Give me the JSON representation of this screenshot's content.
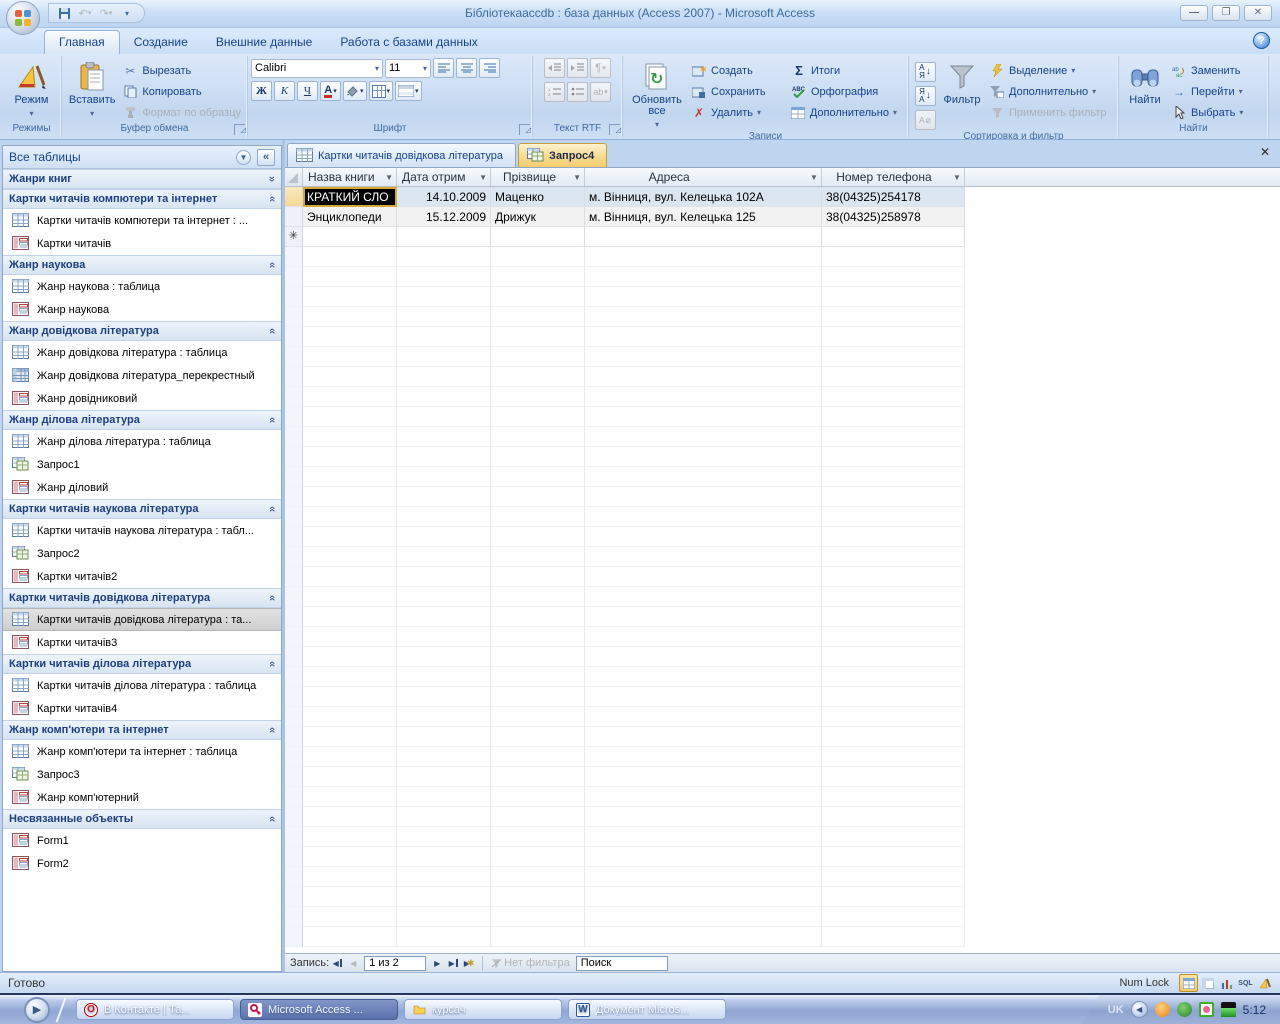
{
  "title_bar": {
    "title": "Бібліотекаaccdb : база данных (Access 2007) - Microsoft Access",
    "minimize": "—",
    "restore": "❐",
    "close": "✕"
  },
  "ribbon": {
    "tabs": [
      "Главная",
      "Создание",
      "Внешние данные",
      "Работа с базами данных"
    ],
    "groups": {
      "views": {
        "label": "Режимы",
        "view_button": "Режим"
      },
      "clipboard": {
        "label": "Буфер обмена",
        "paste": "Вставить",
        "cut": "Вырезать",
        "copy": "Копировать",
        "format_painter": "Формат по образцу"
      },
      "font": {
        "label": "Шрифт",
        "font_name": "Calibri",
        "font_size": "11",
        "bold": "Ж",
        "italic": "К",
        "underline": "Ч"
      },
      "rich_text": {
        "label": "Текст RTF"
      },
      "records": {
        "label": "Записи",
        "refresh": "Обновить все",
        "new": "Создать",
        "save": "Сохранить",
        "delete": "Удалить",
        "totals": "Итоги",
        "spelling": "Орфография",
        "more": "Дополнительно"
      },
      "sort_filter": {
        "label": "Сортировка и фильтр",
        "filter": "Фильтр",
        "selection": "Выделение",
        "advanced": "Дополнительно",
        "toggle_filter": "Применить фильтр"
      },
      "find": {
        "label": "Найти",
        "find": "Найти",
        "replace": "Заменить",
        "goto": "Перейти",
        "select": "Выбрать"
      }
    }
  },
  "nav": {
    "header": "Все таблицы",
    "groups": [
      {
        "title": "Жанри книг"
      },
      {
        "title": "Картки читачів компютери та інтернет",
        "items": [
          {
            "label": "Картки читачів компютери та інтернет : ..."
          },
          {
            "label": "Картки читачів"
          }
        ]
      },
      {
        "title": "Жанр наукова",
        "items": [
          {
            "label": "Жанр наукова : таблица"
          },
          {
            "label": "Жанр наукова"
          }
        ]
      },
      {
        "title": "Жанр довідкова література",
        "items": [
          {
            "label": "Жанр довідкова література : таблица"
          },
          {
            "label": "Жанр довідкова література_перекрестный"
          },
          {
            "label": "Жанр довідниковий"
          }
        ]
      },
      {
        "title": "Жанр ділова література",
        "items": [
          {
            "label": "Жанр ділова література : таблица"
          },
          {
            "label": "Запрос1"
          },
          {
            "label": "Жанр діловий"
          }
        ]
      },
      {
        "title": "Картки читачів наукова література",
        "items": [
          {
            "label": "Картки читачів наукова література : табл..."
          },
          {
            "label": "Запрос2"
          },
          {
            "label": "Картки читачів2"
          }
        ]
      },
      {
        "title": "Картки читачів довідкова література",
        "items": [
          {
            "label": "Картки читачів довідкова література : та..."
          },
          {
            "label": "Картки читачів3"
          }
        ]
      },
      {
        "title": "Картки читачів ділова література",
        "items": [
          {
            "label": "Картки читачів ділова література : таблица"
          },
          {
            "label": "Картки читачів4"
          }
        ]
      },
      {
        "title": "Жанр комп'ютери та інтернет",
        "items": [
          {
            "label": "Жанр комп'ютери та інтернет : таблица"
          },
          {
            "label": "Запрос3"
          },
          {
            "label": "Жанр комп'ютерний"
          }
        ]
      },
      {
        "title": "Несвязанные объекты",
        "items": [
          {
            "label": "Form1"
          },
          {
            "label": "Form2"
          }
        ]
      }
    ]
  },
  "document": {
    "tabs": [
      {
        "label": "Картки читачів довідкова література"
      },
      {
        "label": "Запрос4"
      }
    ],
    "datasheet": {
      "columns": [
        "Назва книги",
        "Дата отрим",
        "Прізвище",
        "Адреса",
        "Номер телефона"
      ],
      "rows": [
        [
          "КРАТКИЙ СЛО",
          "14.10.2009",
          "Маценко",
          "м. Вінниця, вул. Келецька 102А",
          "38(04325)254178"
        ],
        [
          "Энциклопеди",
          "15.12.2009",
          "Дрижук",
          "м. Вінниця, вул. Келецька 125",
          "38(04325)258978"
        ]
      ]
    },
    "record_nav": {
      "label": "Запись:",
      "position": "1 из 2",
      "filter_state": "Нет фильтра",
      "search_placeholder": "Поиск"
    }
  },
  "status_bar": {
    "left": "Готово",
    "numlock": "Num Lock",
    "sql": "SQL"
  },
  "taskbar": {
    "tasks": [
      {
        "label": "В Контакте | Та..."
      },
      {
        "label": "Microsoft Access ..."
      },
      {
        "label": "курсач"
      },
      {
        "label": "Документ Micros..."
      }
    ],
    "tray": {
      "lang": "UK",
      "clock": "5:12"
    }
  }
}
